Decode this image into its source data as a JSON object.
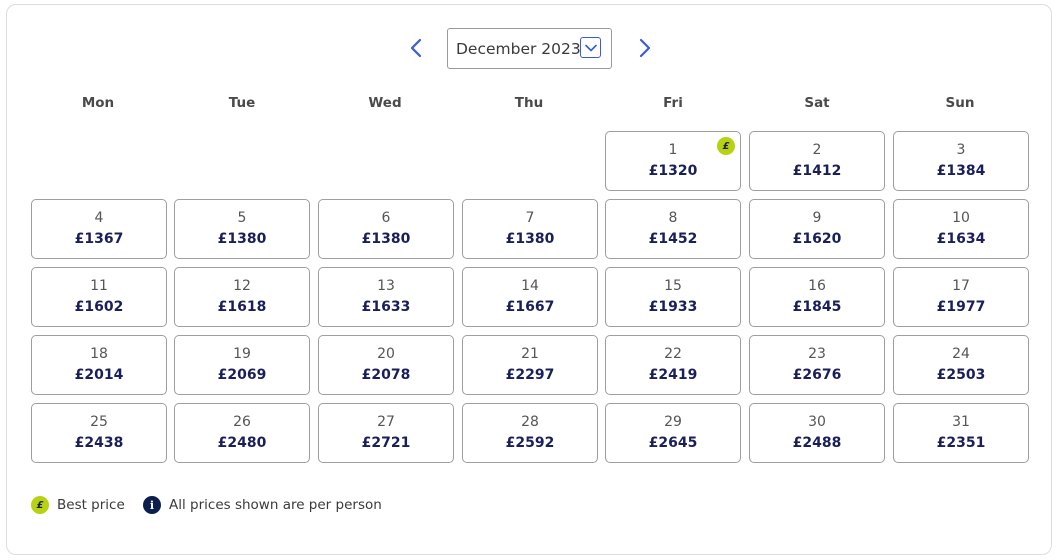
{
  "header": {
    "month_label": "December 2023",
    "prev_icon": "chevron-left-icon",
    "next_icon": "chevron-right-icon",
    "dropdown_icon": "chevron-down-icon"
  },
  "weekdays": [
    "Mon",
    "Tue",
    "Wed",
    "Thu",
    "Fri",
    "Sat",
    "Sun"
  ],
  "days": [
    {
      "day": "1",
      "price": "£1320",
      "best": true
    },
    {
      "day": "2",
      "price": "£1412"
    },
    {
      "day": "3",
      "price": "£1384"
    },
    {
      "day": "4",
      "price": "£1367"
    },
    {
      "day": "5",
      "price": "£1380"
    },
    {
      "day": "6",
      "price": "£1380"
    },
    {
      "day": "7",
      "price": "£1380"
    },
    {
      "day": "8",
      "price": "£1452"
    },
    {
      "day": "9",
      "price": "£1620"
    },
    {
      "day": "10",
      "price": "£1634"
    },
    {
      "day": "11",
      "price": "£1602"
    },
    {
      "day": "12",
      "price": "£1618"
    },
    {
      "day": "13",
      "price": "£1633"
    },
    {
      "day": "14",
      "price": "£1667"
    },
    {
      "day": "15",
      "price": "£1933"
    },
    {
      "day": "16",
      "price": "£1845"
    },
    {
      "day": "17",
      "price": "£1977"
    },
    {
      "day": "18",
      "price": "£2014"
    },
    {
      "day": "19",
      "price": "£2069"
    },
    {
      "day": "20",
      "price": "£2078"
    },
    {
      "day": "21",
      "price": "£2297"
    },
    {
      "day": "22",
      "price": "£2419"
    },
    {
      "day": "23",
      "price": "£2676"
    },
    {
      "day": "24",
      "price": "£2503"
    },
    {
      "day": "25",
      "price": "£2438"
    },
    {
      "day": "26",
      "price": "£2480"
    },
    {
      "day": "27",
      "price": "£2721"
    },
    {
      "day": "28",
      "price": "£2592"
    },
    {
      "day": "29",
      "price": "£2645"
    },
    {
      "day": "30",
      "price": "£2488"
    },
    {
      "day": "31",
      "price": "£2351"
    }
  ],
  "first_weekday_index": 4,
  "legend": {
    "best_price_symbol": "£",
    "best_price_label": "Best price",
    "info_symbol": "i",
    "info_label": "All prices shown are per person"
  },
  "colors": {
    "best_badge": "#b7d30f",
    "price_text": "#1a1f5c",
    "accent": "#3a5bd9",
    "info_badge": "#0b1f4e"
  }
}
